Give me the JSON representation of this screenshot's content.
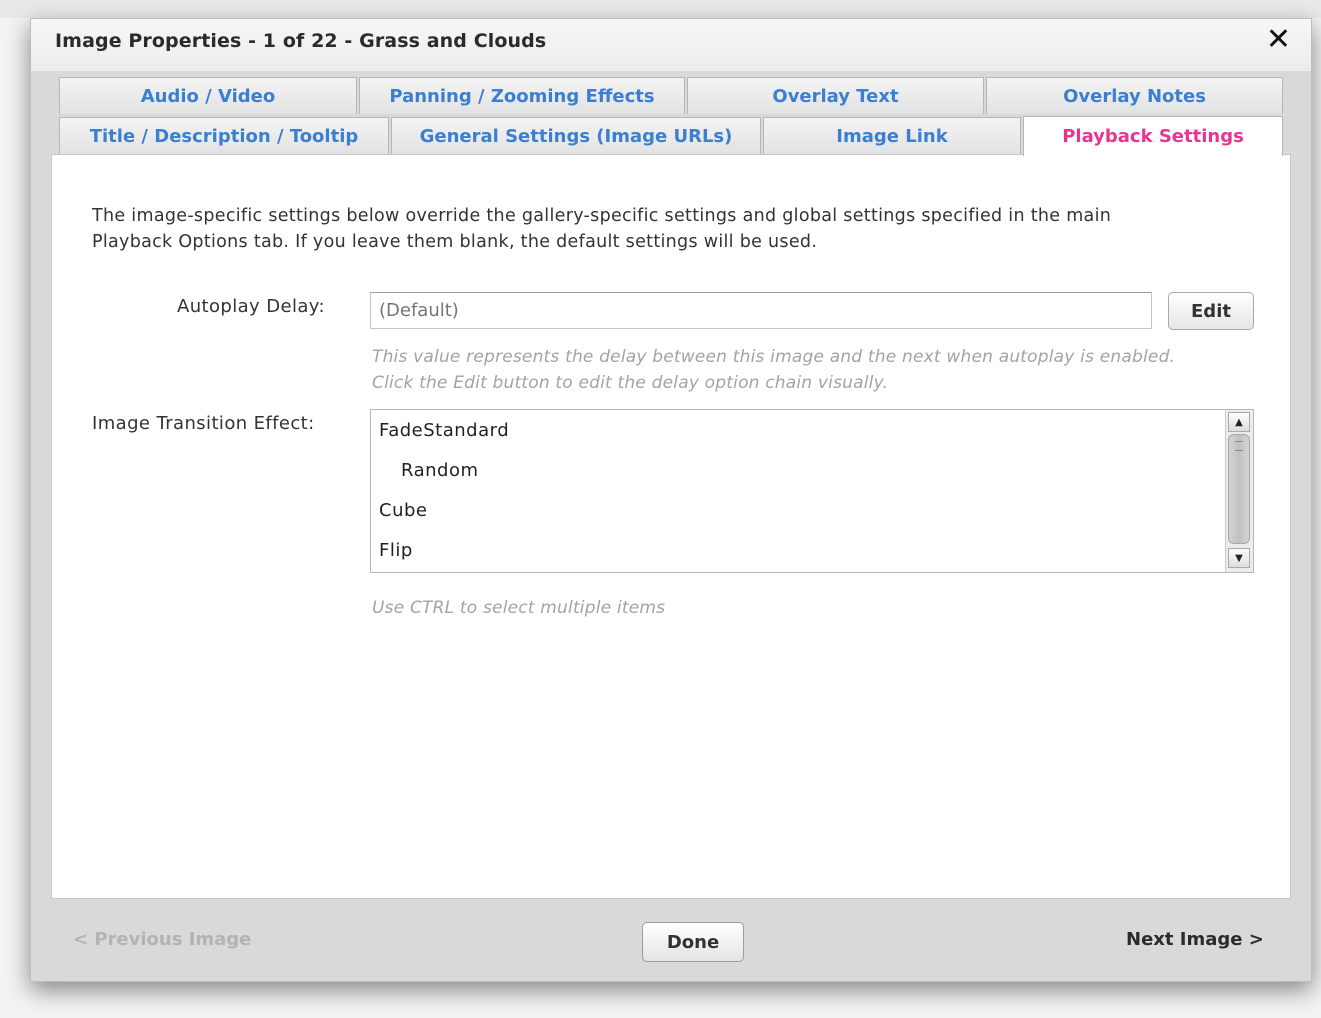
{
  "dialog": {
    "title": "Image Properties - 1 of 22 - Grass and Clouds",
    "close_label": "✕"
  },
  "tabs_row1": [
    {
      "label": "Audio / Video"
    },
    {
      "label": "Panning / Zooming Effects"
    },
    {
      "label": "Overlay Text"
    },
    {
      "label": "Overlay Notes"
    }
  ],
  "tabs_row2": [
    {
      "label": "Title / Description / Tooltip"
    },
    {
      "label": "General Settings (Image URLs)"
    },
    {
      "label": "Image Link"
    },
    {
      "label": "Playback Settings",
      "active": true
    }
  ],
  "playback": {
    "intro_line1": "The image-specific settings below override the gallery-specific settings and global settings specified in the main",
    "intro_line2": "Playback Options tab.  If you leave them blank, the default settings will be used.",
    "autoplay_label": "Autoplay Delay:",
    "autoplay_placeholder": "(Default)",
    "edit_label": "Edit",
    "autoplay_hint1": "This value represents the delay between this image and the next when autoplay is enabled.",
    "autoplay_hint2": "Click the Edit button to edit the delay option chain visually.",
    "transition_label": "Image Transition Effect:",
    "transition_options": [
      "FadeStandard",
      "Random",
      "Cube",
      "Flip"
    ],
    "transition_hint": "Use CTRL to select multiple items"
  },
  "footer": {
    "previous_label": "< Previous Image",
    "done_label": "Done",
    "next_label": "Next Image >"
  },
  "colors": {
    "tab_text": "#3b7fd1",
    "active_tab_text": "#e8358d",
    "disabled_link": "#b3b3b3"
  }
}
